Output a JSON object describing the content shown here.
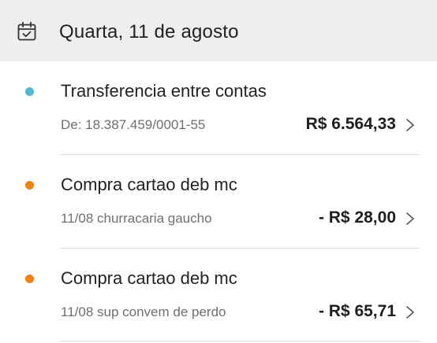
{
  "header": {
    "date": "Quarta, 11 de agosto",
    "icon": "calendar-check-icon"
  },
  "transactions": [
    {
      "title": "Transferencia entre contas",
      "detail": "De: 18.387.459/0001-55",
      "amount": "R$ 6.564,33",
      "dot_color": "#4fb9d1"
    },
    {
      "title": "Compra cartao deb mc",
      "detail": "11/08 churracaria gaucho",
      "amount": "- R$ 28,00",
      "dot_color": "#f0820f"
    },
    {
      "title": "Compra cartao deb mc",
      "detail": "11/08 sup convem de perdo",
      "amount": "- R$ 65,71",
      "dot_color": "#f0820f"
    }
  ]
}
